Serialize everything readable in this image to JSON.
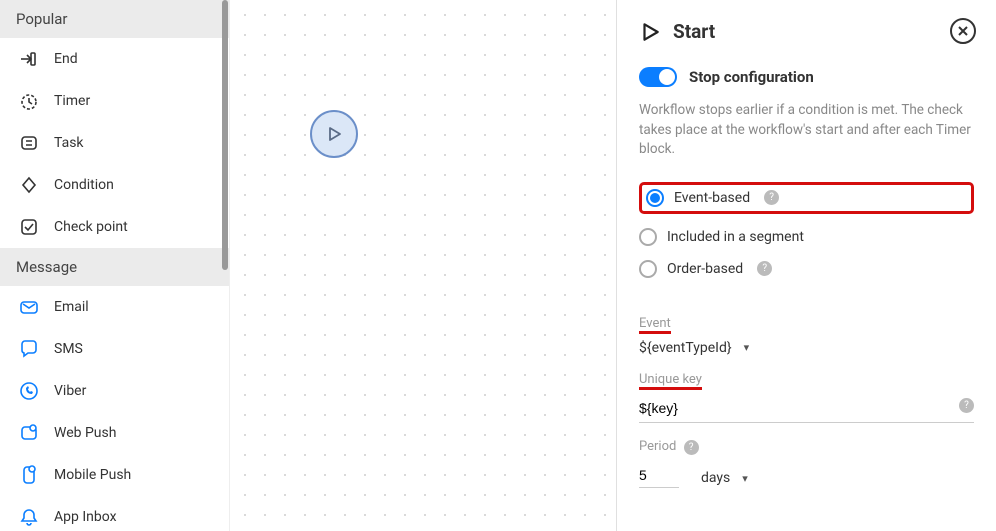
{
  "sidebar": {
    "sections": [
      {
        "title": "Popular",
        "items": [
          {
            "label": "End",
            "icon": "end-icon"
          },
          {
            "label": "Timer",
            "icon": "timer-icon"
          },
          {
            "label": "Task",
            "icon": "task-icon"
          },
          {
            "label": "Condition",
            "icon": "condition-icon"
          },
          {
            "label": "Check point",
            "icon": "checkpoint-icon"
          }
        ]
      },
      {
        "title": "Message",
        "items": [
          {
            "label": "Email",
            "icon": "email-icon"
          },
          {
            "label": "SMS",
            "icon": "sms-icon"
          },
          {
            "label": "Viber",
            "icon": "viber-icon"
          },
          {
            "label": "Web Push",
            "icon": "webpush-icon"
          },
          {
            "label": "Mobile Push",
            "icon": "mobilepush-icon"
          },
          {
            "label": "App Inbox",
            "icon": "appinbox-icon"
          }
        ]
      }
    ]
  },
  "panel": {
    "title": "Start",
    "toggle_label": "Stop configuration",
    "help": "Workflow stops earlier if a condition is met. The check takes place at the workflow's start and after each Timer block.",
    "radios": [
      {
        "label": "Event-based",
        "help": true,
        "selected": true
      },
      {
        "label": "Included in a segment",
        "help": false,
        "selected": false
      },
      {
        "label": "Order-based",
        "help": true,
        "selected": false
      }
    ],
    "event_label": "Event",
    "event_value": "${eventTypeId}",
    "unique_key_label": "Unique key",
    "unique_key_value": "${key}",
    "period_label": "Period",
    "period_value": "5",
    "period_unit": "days"
  }
}
